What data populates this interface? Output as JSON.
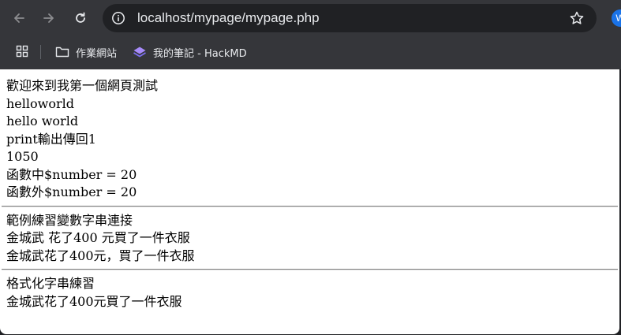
{
  "browser": {
    "url": "localhost/mypage/mypage.php",
    "profile_initial": "W",
    "accent": "#1a73e8"
  },
  "bookmarks": [
    {
      "label": "作業網站",
      "icon": "folder-icon"
    },
    {
      "label": "我的筆記 - HackMD",
      "icon": "hackmd-icon"
    }
  ],
  "page": {
    "section1": [
      "歡迎來到我第一個網頁測試",
      "helloworld",
      "hello world",
      "print輸出傳回1",
      "1050",
      "函數中$number = 20",
      "函數外$number = 20"
    ],
    "section2": [
      "範例練習變數字串連接",
      "金城武 花了400 元買了一件衣服",
      "金城武花了400元，買了一件衣服"
    ],
    "section3": [
      "格式化字串練習",
      "金城武花了400元買了一件衣服"
    ]
  }
}
